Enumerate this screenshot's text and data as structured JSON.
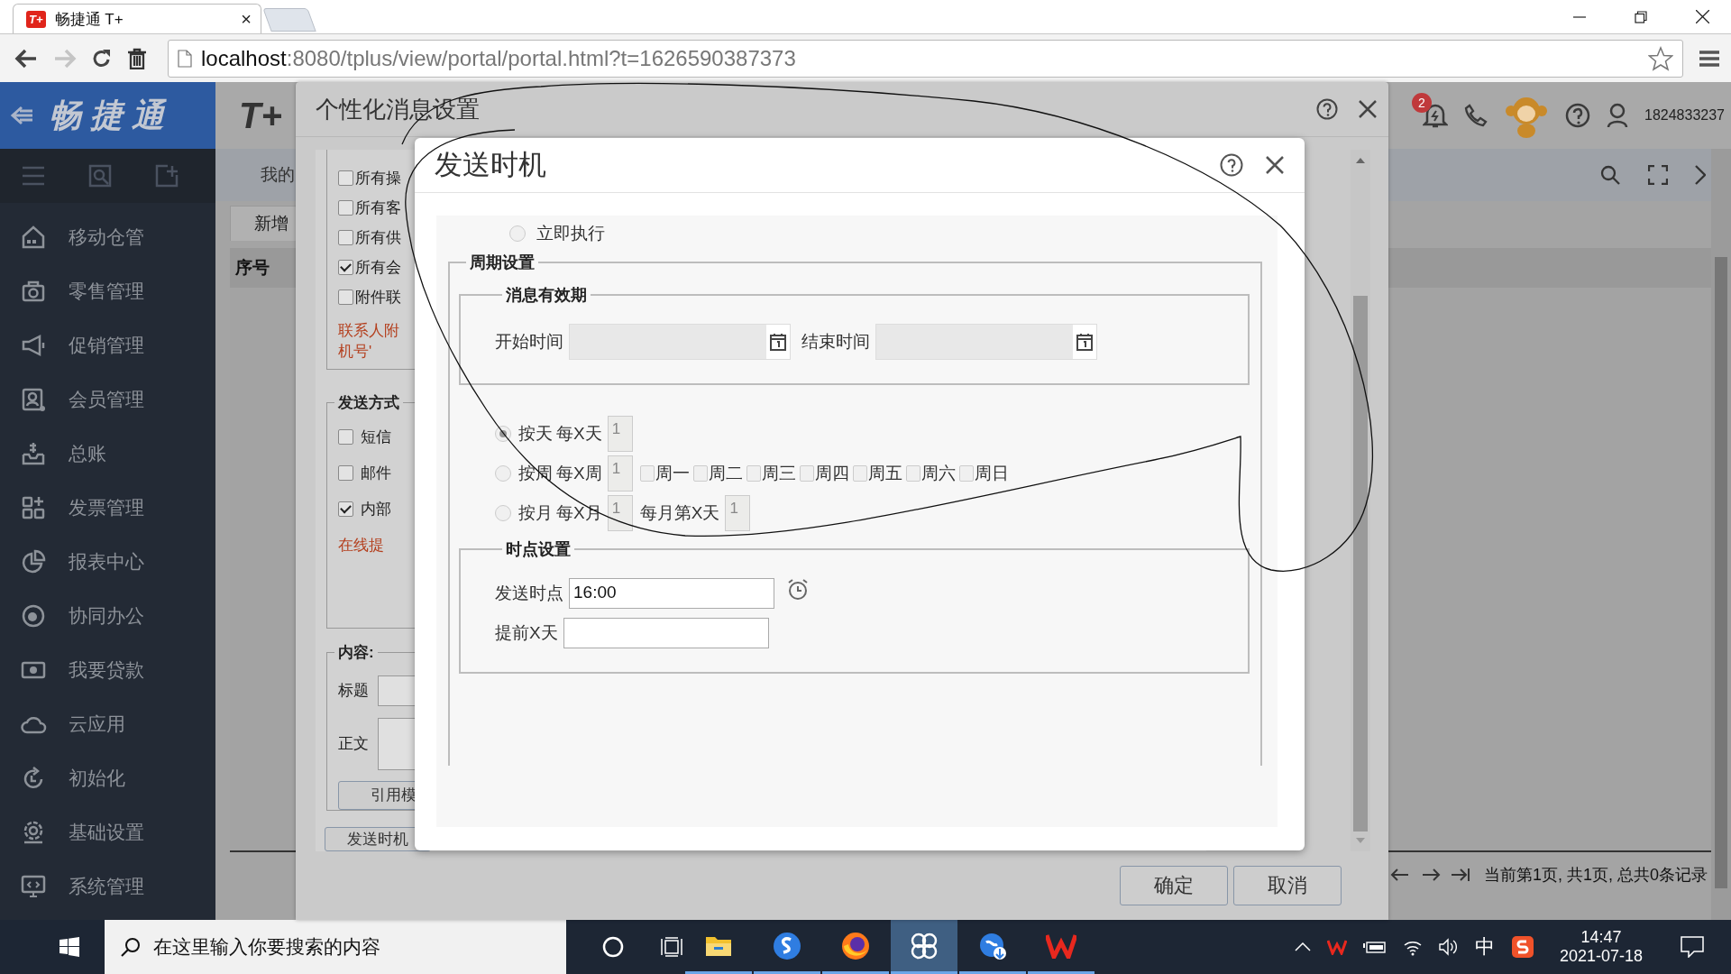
{
  "browser": {
    "tab": {
      "favicon": "T+",
      "title": "畅捷通 T+",
      "close": "×"
    },
    "url_host": "localhost",
    "url_rest": ":8080/tplus/view/portal/portal.html?t=1626590387373"
  },
  "sidebar": {
    "logo": "畅捷通",
    "items": [
      {
        "label": "移动仓管"
      },
      {
        "label": "零售管理"
      },
      {
        "label": "促销管理"
      },
      {
        "label": "会员管理"
      },
      {
        "label": "总账"
      },
      {
        "label": "发票管理"
      },
      {
        "label": "报表中心"
      },
      {
        "label": "协同办公"
      },
      {
        "label": "我要贷款"
      },
      {
        "label": "云应用"
      },
      {
        "label": "初始化"
      },
      {
        "label": "基础设置"
      },
      {
        "label": "系统管理"
      }
    ]
  },
  "header": {
    "logo": "T+",
    "badge": "2",
    "account": "1824833237"
  },
  "main": {
    "tab": "我的",
    "toolbar_button": "新增",
    "column_1": "序号",
    "pagination": "当前第1页, 共1页, 总共0条记录"
  },
  "settings_dialog": {
    "title": "个性化消息设置",
    "recipients": [
      {
        "label": "所有操",
        "checked": false
      },
      {
        "label": "所有客",
        "checked": false
      },
      {
        "label": "所有供",
        "checked": false
      },
      {
        "label": "所有会",
        "checked": true
      },
      {
        "label": "附件联",
        "checked": false
      }
    ],
    "note_lines": [
      "联系人附",
      "机号'"
    ],
    "send_method": {
      "legend": "发送方式",
      "options": [
        {
          "label": "短信",
          "checked": false
        },
        {
          "label": "邮件",
          "checked": false
        },
        {
          "label": "内部",
          "checked": true
        }
      ],
      "online_hint": "在线提"
    },
    "content": {
      "legend": "内容:",
      "title_label": "标题",
      "body_label": "正文",
      "template_button": "引用模"
    },
    "timing_button": "发送时机",
    "buttons": [
      "确定",
      "取消"
    ]
  },
  "timing_dialog": {
    "title": "发送时机",
    "immediate": {
      "label": "立即执行",
      "selected": false
    },
    "period_legend": "周期设置",
    "validity_legend": "消息有效期",
    "start_label": "开始时间",
    "end_label": "结束时间",
    "modes": [
      {
        "kind": "day",
        "label": "按天",
        "every": "每X天",
        "value": "1",
        "selected": true
      },
      {
        "kind": "week",
        "label": "按周",
        "every": "每X周",
        "value": "1",
        "selected": false,
        "weekdays": [
          {
            "label": "周一",
            "checked": false
          },
          {
            "label": "周二",
            "checked": false
          },
          {
            "label": "周三",
            "checked": false
          },
          {
            "label": "周四",
            "checked": false
          },
          {
            "label": "周五",
            "checked": false
          },
          {
            "label": "周六",
            "checked": false
          },
          {
            "label": "周日",
            "checked": false
          }
        ]
      },
      {
        "kind": "month",
        "label": "按月",
        "every": "每X月",
        "value": "1",
        "selected": false,
        "day_label": "每月第X天",
        "day_value": "1"
      }
    ],
    "time_legend": "时点设置",
    "send_time_label": "发送时点",
    "send_time": "16:00",
    "advance_label": "提前X天"
  },
  "taskbar": {
    "search_placeholder": "在这里输入你要搜索的内容",
    "ime": "中",
    "time": "14:47",
    "date": "2021-07-18"
  }
}
